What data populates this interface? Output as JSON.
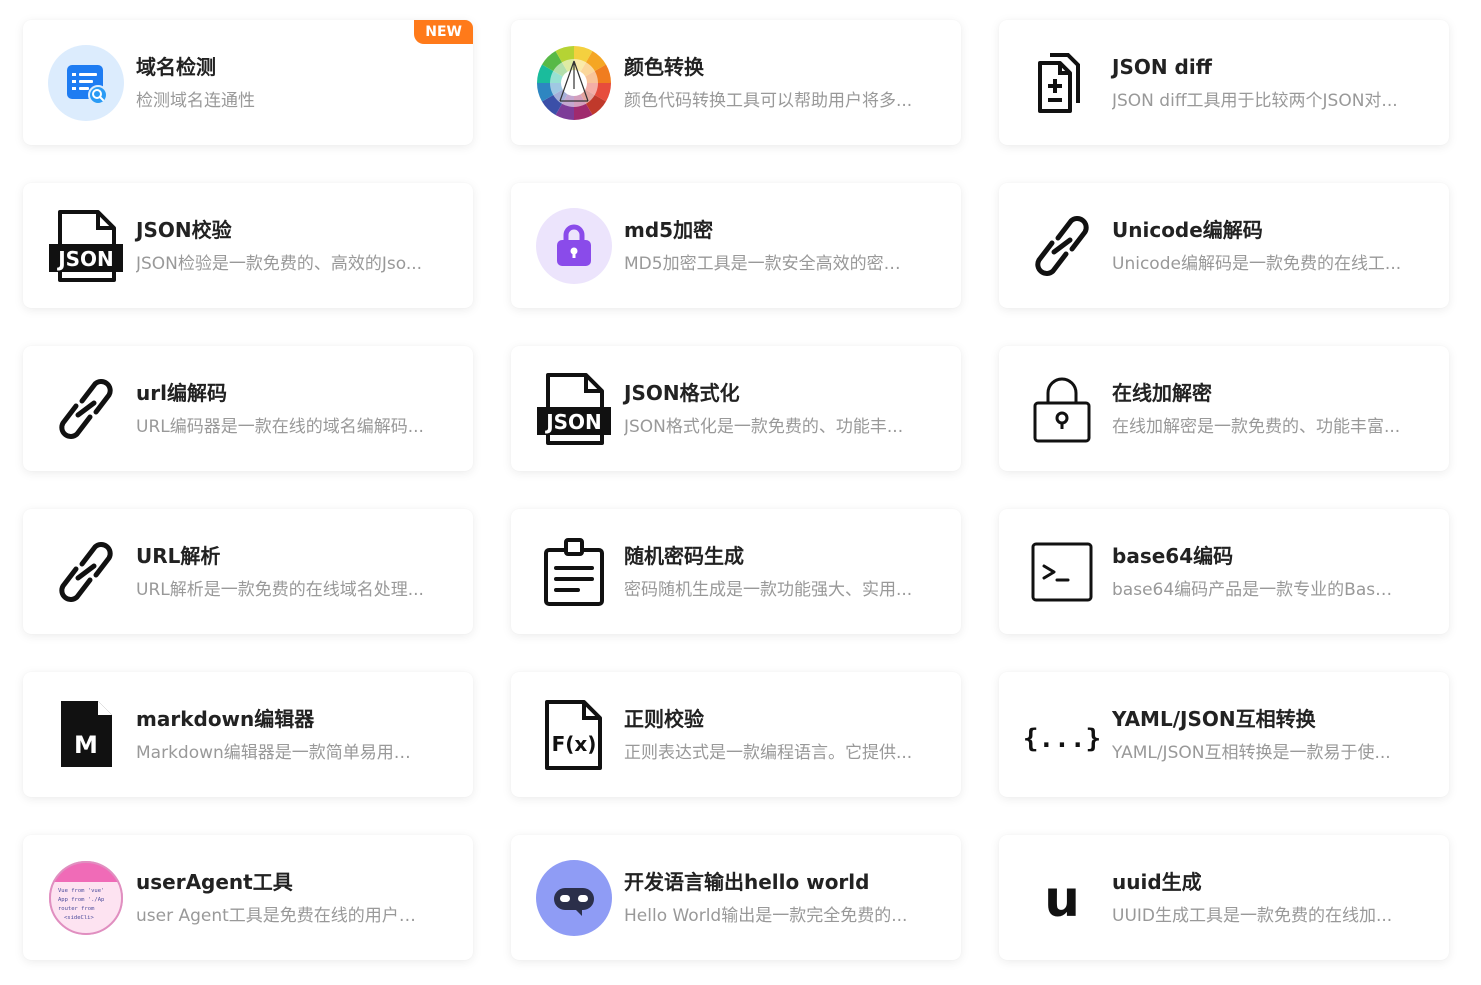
{
  "badge": {
    "new_label": "NEW"
  },
  "cards": [
    {
      "title": "域名检测",
      "desc": "检测域名连通性",
      "icon": "domain-check-icon"
    },
    {
      "title": "颜色转换",
      "desc": "颜色代码转换工具可以帮助用户将多...",
      "icon": "color-wheel-icon"
    },
    {
      "title": "JSON diff",
      "desc": "JSON diff工具用于比较两个JSON对...",
      "icon": "file-diff-icon"
    },
    {
      "title": "JSON校验",
      "desc": "JSON检验是一款免费的、高效的Jso...",
      "icon": "json-file-icon",
      "icon_text": "JSON"
    },
    {
      "title": "md5加密",
      "desc": "MD5加密工具是一款安全高效的密码...",
      "icon": "purple-lock-icon"
    },
    {
      "title": "Unicode编解码",
      "desc": "Unicode编解码是一款免费的在线工...",
      "icon": "link-icon"
    },
    {
      "title": "url编解码",
      "desc": "URL编码器是一款在线的域名编解码...",
      "icon": "link-icon"
    },
    {
      "title": "JSON格式化",
      "desc": "JSON格式化是一款免费的、功能丰...",
      "icon": "json-file-icon",
      "icon_text": "JSON"
    },
    {
      "title": "在线加解密",
      "desc": "在线加解密是一款免费的、功能丰富...",
      "icon": "padlock-icon"
    },
    {
      "title": "URL解析",
      "desc": "URL解析是一款免费的在线域名处理...",
      "icon": "link-icon"
    },
    {
      "title": "随机密码生成",
      "desc": "密码随机生成是一款功能强大、实用...",
      "icon": "clipboard-icon"
    },
    {
      "title": "base64编码",
      "desc": "base64编码产品是一款专业的Base6...",
      "icon": "terminal-icon"
    },
    {
      "title": "markdown编辑器",
      "desc": "Markdown编辑器是一款简单易用的...",
      "icon": "markdown-file-icon",
      "icon_text": "M"
    },
    {
      "title": "正则校验",
      "desc": "正则表达式是一款编程语言。它提供...",
      "icon": "function-file-icon",
      "icon_text": "F(x)"
    },
    {
      "title": "YAML/JSON互相转换",
      "desc": "YAML/JSON互相转换是一款易于使...",
      "icon": "braces-icon",
      "icon_text": "{...}"
    },
    {
      "title": "userAgent工具",
      "desc": "user Agent工具是免费在线的用户机...",
      "icon": "code-snippet-avatar-icon",
      "icon_lines": [
        "Vue from 'vue'",
        "App from './Ap",
        "router from",
        "<sideCli>"
      ]
    },
    {
      "title": "开发语言输出hello world",
      "desc": "Hello World输出是一款完全免费的...",
      "icon": "robot-face-icon"
    },
    {
      "title": "uuid生成",
      "desc": "UUID生成工具是一款免费的在线加...",
      "icon": "letter-u-icon",
      "icon_text": "u"
    }
  ]
}
